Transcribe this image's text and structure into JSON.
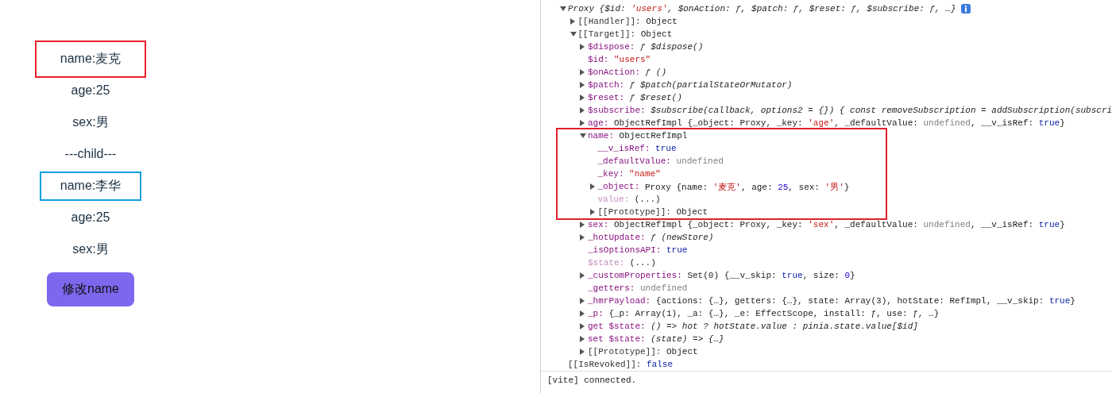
{
  "app": {
    "items": [
      {
        "text": "name:麦克",
        "outlined": true,
        "color": "#e8202a"
      },
      {
        "text": "age:25",
        "outlined": false
      },
      {
        "text": "sex:男",
        "outlined": false
      },
      {
        "text": "---child---",
        "outlined": false
      },
      {
        "text": "name:李华",
        "outlined": true,
        "color": "#0ea0e0"
      },
      {
        "text": "age:25",
        "outlined": false
      },
      {
        "text": "sex:男",
        "outlined": false
      }
    ],
    "button": "修改name"
  },
  "console": {
    "tree": [
      {
        "kind": "header",
        "expanded": true,
        "info": true,
        "value": [
          {
            "text": "Proxy {$id: ",
            "kind": "italic"
          },
          {
            "text": "'users'",
            "kind": "string-italic"
          },
          {
            "text": ", $onAction: ƒ, $patch: ƒ, $reset: ƒ, $subscribe: ƒ, …}",
            "kind": "italic"
          }
        ],
        "children": [
          {
            "key": "[[Handler]]:",
            "kind": "internal",
            "expanded": false,
            "value": [
              {
                "text": "Object",
                "kind": "text"
              }
            ]
          },
          {
            "key": "[[Target]]:",
            "kind": "internal",
            "expanded": true,
            "value": [
              {
                "text": "Object",
                "kind": "text"
              }
            ],
            "children": [
              {
                "key": "$dispose:",
                "kind": "property",
                "dimmed": false,
                "expanded": false,
                "value": [
                  {
                    "text": "ƒ $dispose()",
                    "kind": "italic"
                  }
                ]
              },
              {
                "key": "$id:",
                "kind": "property",
                "dimmed": false,
                "value": [
                  {
                    "text": "\"users\"",
                    "kind": "string"
                  }
                ]
              },
              {
                "key": "$onAction:",
                "kind": "property",
                "dimmed": false,
                "expanded": false,
                "value": [
                  {
                    "text": "ƒ ()",
                    "kind": "italic"
                  }
                ]
              },
              {
                "key": "$patch:",
                "kind": "property",
                "dimmed": false,
                "expanded": false,
                "value": [
                  {
                    "text": "ƒ $patch(partialStateOrMutator)",
                    "kind": "italic"
                  }
                ]
              },
              {
                "key": "$reset:",
                "kind": "property",
                "dimmed": false,
                "expanded": false,
                "value": [
                  {
                    "text": "ƒ $reset()",
                    "kind": "italic"
                  }
                ]
              },
              {
                "key": "$subscribe:",
                "kind": "property",
                "dimmed": false,
                "expanded": false,
                "value": [
                  {
                    "text": "$subscribe(callback, options2 = {}) { const removeSubscription = addSubscription(subscri",
                    "kind": "italic"
                  }
                ]
              },
              {
                "key": "age:",
                "kind": "property",
                "dimmed": false,
                "expanded": false,
                "value": [
                  {
                    "text": "ObjectRefImpl {_object: Proxy, _key: ",
                    "kind": "text"
                  },
                  {
                    "text": "'age'",
                    "kind": "string"
                  },
                  {
                    "text": ", _defaultValue: ",
                    "kind": "text"
                  },
                  {
                    "text": "undefined",
                    "kind": "undefined"
                  },
                  {
                    "text": ", __v_isRef: ",
                    "kind": "text"
                  },
                  {
                    "text": "true",
                    "kind": "keyword"
                  },
                  {
                    "text": "}",
                    "kind": "text"
                  }
                ]
              },
              {
                "key": "name:",
                "kind": "property",
                "dimmed": false,
                "expanded": true,
                "highlighted": true,
                "value": [
                  {
                    "text": "ObjectRefImpl",
                    "kind": "text"
                  }
                ],
                "children": [
                  {
                    "key": "__v_isRef:",
                    "kind": "property",
                    "dimmed": false,
                    "value": [
                      {
                        "text": "true",
                        "kind": "keyword"
                      }
                    ]
                  },
                  {
                    "key": "_defaultValue:",
                    "kind": "property",
                    "dimmed": false,
                    "value": [
                      {
                        "text": "undefined",
                        "kind": "undefined"
                      }
                    ]
                  },
                  {
                    "key": "_key:",
                    "kind": "property",
                    "dimmed": false,
                    "value": [
                      {
                        "text": "\"name\"",
                        "kind": "string"
                      }
                    ]
                  },
                  {
                    "key": "_object:",
                    "kind": "property",
                    "dimmed": false,
                    "expanded": false,
                    "value": [
                      {
                        "text": "Proxy {name: ",
                        "kind": "text"
                      },
                      {
                        "text": "'麦克'",
                        "kind": "string"
                      },
                      {
                        "text": ", age: ",
                        "kind": "text"
                      },
                      {
                        "text": "25",
                        "kind": "number"
                      },
                      {
                        "text": ", sex: ",
                        "kind": "text"
                      },
                      {
                        "text": "'男'",
                        "kind": "string"
                      },
                      {
                        "text": "}",
                        "kind": "text"
                      }
                    ]
                  },
                  {
                    "key": "value:",
                    "kind": "property",
                    "dimmed": true,
                    "value": [
                      {
                        "text": "(...)",
                        "kind": "text"
                      }
                    ]
                  },
                  {
                    "key": "[[Prototype]]:",
                    "kind": "internal",
                    "expanded": false,
                    "value": [
                      {
                        "text": "Object",
                        "kind": "text"
                      }
                    ]
                  }
                ]
              },
              {
                "key": "sex:",
                "kind": "property",
                "dimmed": false,
                "expanded": false,
                "value": [
                  {
                    "text": "ObjectRefImpl {_object: Proxy, _key: ",
                    "kind": "text"
                  },
                  {
                    "text": "'sex'",
                    "kind": "string"
                  },
                  {
                    "text": ", _defaultValue: ",
                    "kind": "text"
                  },
                  {
                    "text": "undefined",
                    "kind": "undefined"
                  },
                  {
                    "text": ", __v_isRef: ",
                    "kind": "text"
                  },
                  {
                    "text": "true",
                    "kind": "keyword"
                  },
                  {
                    "text": "}",
                    "kind": "text"
                  }
                ]
              },
              {
                "key": "_hotUpdate:",
                "kind": "property",
                "dimmed": false,
                "expanded": false,
                "value": [
                  {
                    "text": "ƒ (newStore)",
                    "kind": "italic"
                  }
                ]
              },
              {
                "key": "_isOptionsAPI:",
                "kind": "property",
                "dimmed": false,
                "value": [
                  {
                    "text": "true",
                    "kind": "keyword"
                  }
                ]
              },
              {
                "key": "$state:",
                "kind": "property",
                "dimmed": true,
                "value": [
                  {
                    "text": "(...)",
                    "kind": "text"
                  }
                ]
              },
              {
                "key": "_customProperties:",
                "kind": "property",
                "dimmed": false,
                "expanded": false,
                "value": [
                  {
                    "text": "Set(0) {__v_skip: ",
                    "kind": "text"
                  },
                  {
                    "text": "true",
                    "kind": "keyword"
                  },
                  {
                    "text": ", size: ",
                    "kind": "text"
                  },
                  {
                    "text": "0",
                    "kind": "number"
                  },
                  {
                    "text": "}",
                    "kind": "text"
                  }
                ]
              },
              {
                "key": "_getters:",
                "kind": "property",
                "dimmed": false,
                "value": [
                  {
                    "text": "undefined",
                    "kind": "undefined"
                  }
                ]
              },
              {
                "key": "_hmrPayload:",
                "kind": "property",
                "dimmed": false,
                "expanded": false,
                "value": [
                  {
                    "text": "{actions: {…}, getters: {…}, state: Array(3), hotState: RefImpl, __v_skip: ",
                    "kind": "text"
                  },
                  {
                    "text": "true",
                    "kind": "keyword"
                  },
                  {
                    "text": "}",
                    "kind": "text"
                  }
                ]
              },
              {
                "key": "_p:",
                "kind": "property",
                "dimmed": false,
                "expanded": false,
                "value": [
                  {
                    "text": "{_p: Array(1), _a: {…}, _e: EffectScope, install: ƒ, use: ƒ, …}",
                    "kind": "text"
                  }
                ]
              },
              {
                "key": "get $state:",
                "kind": "property",
                "dimmed": false,
                "expanded": false,
                "value": [
                  {
                    "text": "() => hot ? hotState.value : pinia.state.value[$id]",
                    "kind": "italic"
                  }
                ]
              },
              {
                "key": "set $state:",
                "kind": "property",
                "dimmed": false,
                "expanded": false,
                "value": [
                  {
                    "text": "(state) => {…}",
                    "kind": "italic"
                  }
                ]
              },
              {
                "key": "[[Prototype]]:",
                "kind": "internal",
                "expanded": false,
                "value": [
                  {
                    "text": "Object",
                    "kind": "text"
                  }
                ]
              }
            ]
          }
        ]
      },
      {
        "key": "[[IsRevoked]]:",
        "kind": "internal",
        "value": [
          {
            "text": "false",
            "kind": "keyword"
          }
        ]
      }
    ],
    "message": "[vite] connected."
  }
}
